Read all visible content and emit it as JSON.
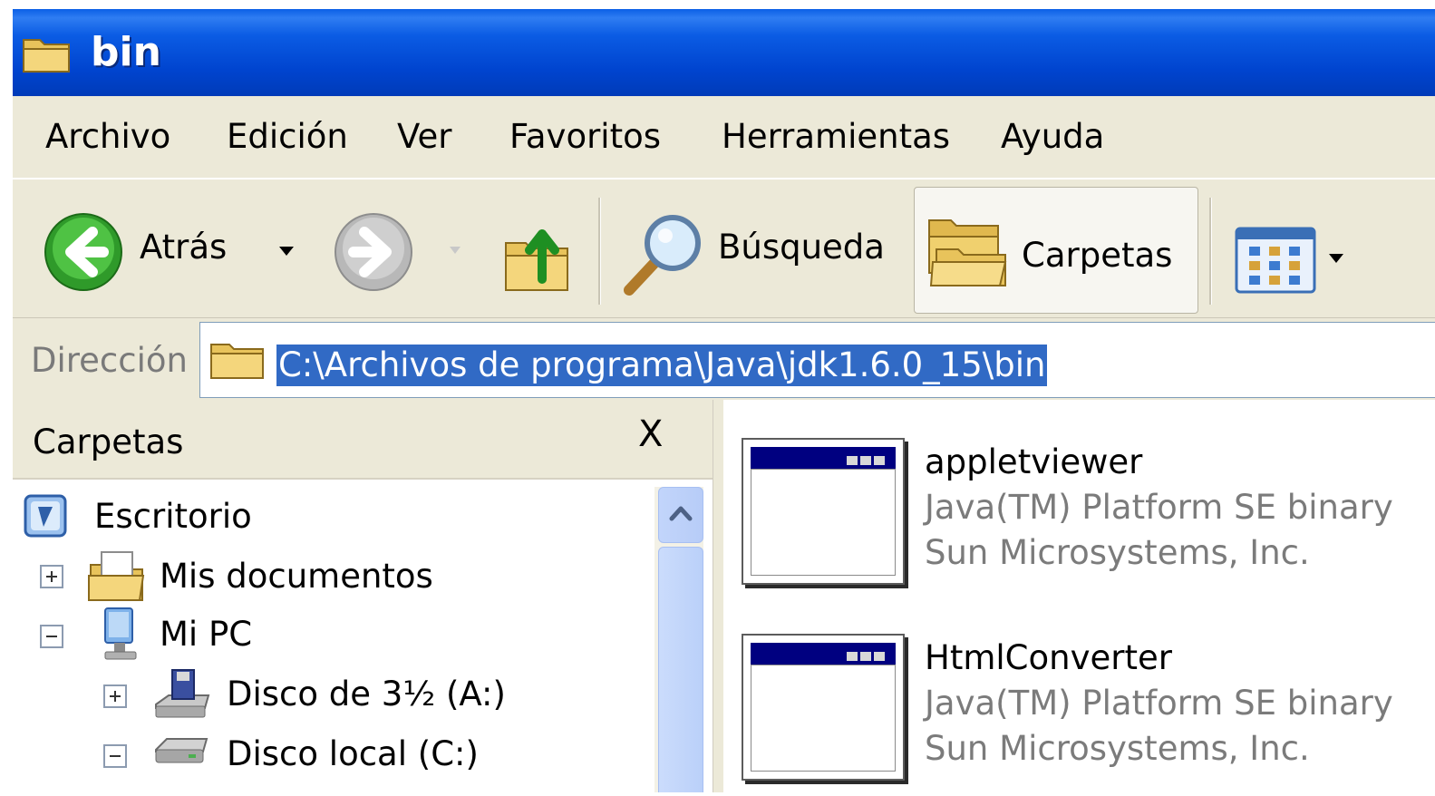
{
  "window": {
    "title": "bin"
  },
  "menu": {
    "items": [
      "Archivo",
      "Edición",
      "Ver",
      "Favoritos",
      "Herramientas",
      "Ayuda"
    ]
  },
  "toolbar": {
    "back_label": "Atrás",
    "search_label": "Búsqueda",
    "folders_label": "Carpetas",
    "icons": [
      "back-arrow-icon",
      "forward-arrow-icon",
      "folder-up-icon",
      "magnifier-icon",
      "folders-icon",
      "views-icon"
    ]
  },
  "address": {
    "label": "Dirección",
    "value": "C:\\Archivos de programa\\Java\\jdk1.6.0_15\\bin"
  },
  "folder_pane": {
    "title": "Carpetas",
    "close_glyph": "X",
    "tree": [
      {
        "label": "Escritorio",
        "icon": "desktop-icon"
      },
      {
        "label": "Mis documentos",
        "icon": "my-documents-icon",
        "toggle": "+"
      },
      {
        "label": "Mi PC",
        "icon": "my-computer-icon",
        "toggle": "-"
      },
      {
        "label": "Disco de 3½ (A:)",
        "icon": "floppy-drive-icon",
        "toggle": "+"
      },
      {
        "label": "Disco local (C:)",
        "icon": "hard-drive-icon",
        "toggle": "-"
      }
    ]
  },
  "files": [
    {
      "name": "appletviewer",
      "description": "Java(TM) Platform SE binary",
      "company": "Sun Microsystems, Inc.",
      "icon": "application-window-icon"
    },
    {
      "name": "HtmlConverter",
      "description": "Java(TM) Platform SE binary",
      "company": "Sun Microsystems, Inc.",
      "icon": "application-window-icon"
    }
  ],
  "colors": {
    "titlebar": "#0054e3",
    "selection": "#316ac5",
    "chrome": "#ece9d8"
  }
}
